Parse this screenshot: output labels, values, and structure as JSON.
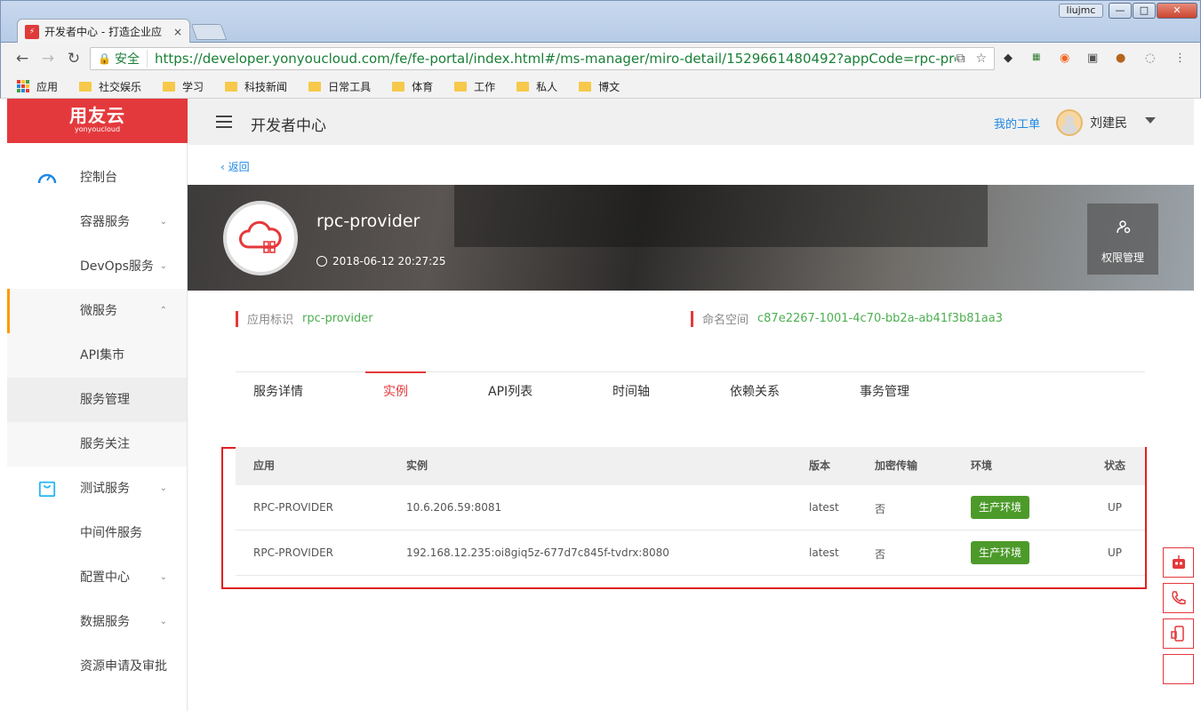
{
  "browser": {
    "tab_title": "开发者中心 - 打造企业应",
    "tab_close": "×",
    "user_badge": "liujmc",
    "win_min": "—",
    "win_max": "□",
    "win_close": "✕",
    "secure_label": "安全",
    "url": "https://developer.yonyoucloud.com/fe/fe-portal/index.html#/ms-manager/miro-detail/1529661480492?appCode=rpc-provider&p...",
    "bookmarks": [
      "应用",
      "社交娱乐",
      "学习",
      "科技新闻",
      "日常工具",
      "体育",
      "工作",
      "私人",
      "博文"
    ]
  },
  "brand": {
    "logo_main": "用友云",
    "logo_sub": "yonyoucloud",
    "color": "#e4393c"
  },
  "sidebar": {
    "items": [
      {
        "label": "控制台",
        "icon": "dashboard-icon"
      },
      {
        "label": "容器服务",
        "chevron": "⌄"
      },
      {
        "label": "DevOps服务",
        "chevron": "⌄"
      },
      {
        "label": "微服务",
        "chevron": "⌃"
      },
      {
        "label": "API集市"
      },
      {
        "label": "服务管理"
      },
      {
        "label": "服务关注"
      },
      {
        "label": "测试服务",
        "icon": "bag-icon",
        "chevron": "⌄"
      },
      {
        "label": "中间件服务"
      },
      {
        "label": "配置中心",
        "chevron": "⌄"
      },
      {
        "label": "数据服务",
        "chevron": "⌄"
      },
      {
        "label": "资源申请及审批"
      }
    ]
  },
  "header": {
    "title": "开发者中心",
    "my_orders": "我的工单",
    "username": "刘建民"
  },
  "detail": {
    "back_label": "返回",
    "app_name": "rpc-provider",
    "created_at": "2018-06-12 20:27:25",
    "perm_label": "权限管理",
    "app_id_key": "应用标识",
    "app_id_value": "rpc-provider",
    "namespace_key": "命名空间",
    "namespace_value": "c87e2267-1001-4c70-bb2a-ab41f3b81aa3"
  },
  "tabs": [
    "服务详情",
    "实例",
    "API列表",
    "时间轴",
    "依赖关系",
    "事务管理"
  ],
  "instances_table": {
    "columns": [
      "应用",
      "实例",
      "版本",
      "加密传输",
      "环境",
      "状态"
    ],
    "rows": [
      [
        "RPC-PROVIDER",
        "10.6.206.59:8081",
        "latest",
        "否",
        "生产环境",
        "UP"
      ],
      [
        "RPC-PROVIDER",
        "192.168.12.235:oi8giq5z-677d7c845f-tvdrx:8080",
        "latest",
        "否",
        "生产环境",
        "UP"
      ]
    ],
    "env_color": "#4c9a2a"
  },
  "float_tools": [
    "robot-icon",
    "phone-icon",
    "mobile-icon",
    "blank"
  ]
}
